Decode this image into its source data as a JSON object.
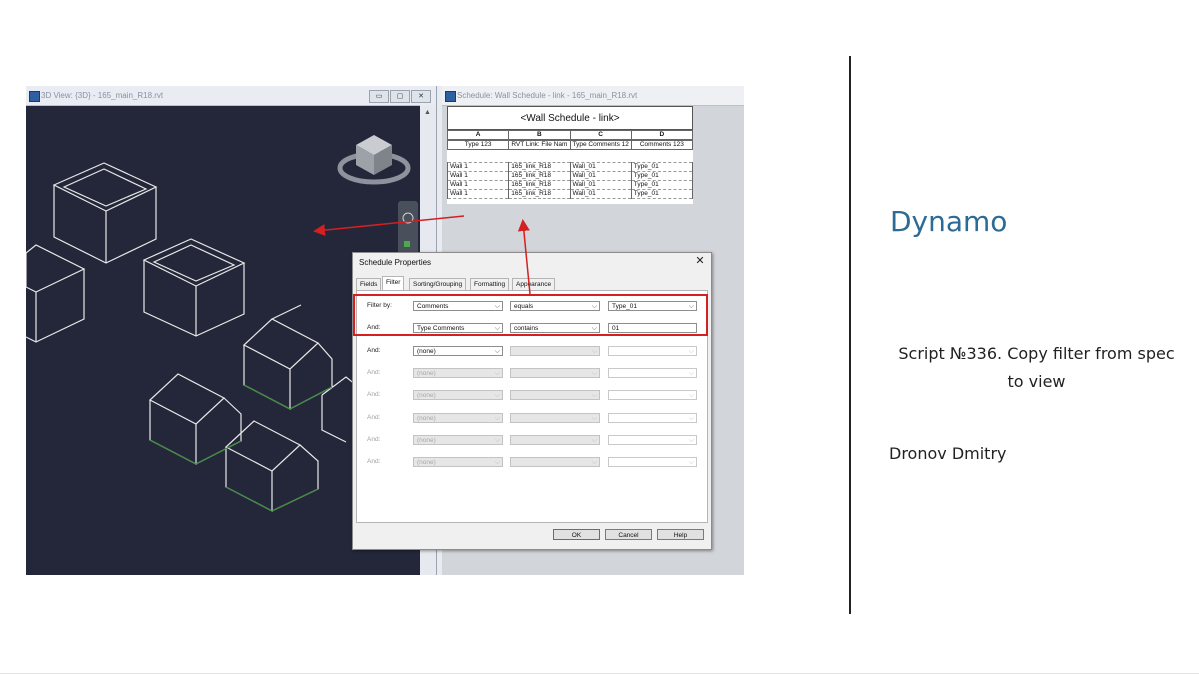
{
  "view3d": {
    "title": "3D View: {3D} - 165_main_R18.rvt",
    "win_buttons": [
      "▭",
      "▢",
      "✕"
    ]
  },
  "schedule_window": {
    "title": "Schedule: Wall Schedule - link - 165_main_R18.rvt",
    "heading": "<Wall Schedule - link>",
    "column_letters": [
      "A",
      "B",
      "C",
      "D"
    ],
    "column_names": [
      "Type 123",
      "RVT Link: File Nam",
      "Type Comments 12",
      "Comments 123"
    ],
    "rows": [
      [
        "Wall 1",
        "165_link_R18",
        "Wall_01",
        "Type_01"
      ],
      [
        "Wall 1",
        "165_link_R18",
        "Wall_01",
        "Type_01"
      ],
      [
        "Wall 1",
        "165_link_R18",
        "Wall_01",
        "Type_01"
      ],
      [
        "Wall 1",
        "165_link_R18",
        "Wall_01",
        "Type_01"
      ]
    ]
  },
  "dialog": {
    "title": "Schedule Properties",
    "close": "✕",
    "tabs": [
      "Fields",
      "Filter",
      "Sorting/Grouping",
      "Formatting",
      "Appearance"
    ],
    "active_tab": "Filter",
    "filters": [
      {
        "label": "Filter by:",
        "field": "Comments",
        "operator": "equals",
        "value": "Type_01",
        "value_is_combo": true,
        "enabled": true
      },
      {
        "label": "And:",
        "field": "Type Comments",
        "operator": "contains",
        "value": "01",
        "value_is_combo": false,
        "enabled": true
      },
      {
        "label": "And:",
        "field": "(none)",
        "operator": "",
        "value": "",
        "value_is_combo": true,
        "enabled": true
      },
      {
        "label": "And:",
        "field": "(none)",
        "operator": "",
        "value": "",
        "value_is_combo": true,
        "enabled": false
      },
      {
        "label": "And:",
        "field": "(none)",
        "operator": "",
        "value": "",
        "value_is_combo": true,
        "enabled": false
      },
      {
        "label": "And:",
        "field": "(none)",
        "operator": "",
        "value": "",
        "value_is_combo": true,
        "enabled": false
      },
      {
        "label": "And:",
        "field": "(none)",
        "operator": "",
        "value": "",
        "value_is_combo": true,
        "enabled": false
      },
      {
        "label": "And:",
        "field": "(none)",
        "operator": "",
        "value": "",
        "value_is_combo": true,
        "enabled": false
      }
    ],
    "buttons": {
      "ok": "OK",
      "cancel": "Cancel",
      "help": "Help"
    }
  },
  "panel": {
    "brand": "Dynamo",
    "script_line1": "Script №336. Copy filter from spec",
    "script_line2": "to view",
    "author": "Dronov Dmitry"
  },
  "colors": {
    "brand": "#2d6b95",
    "highlight": "#d42020",
    "viewport_bg": "#232739"
  }
}
